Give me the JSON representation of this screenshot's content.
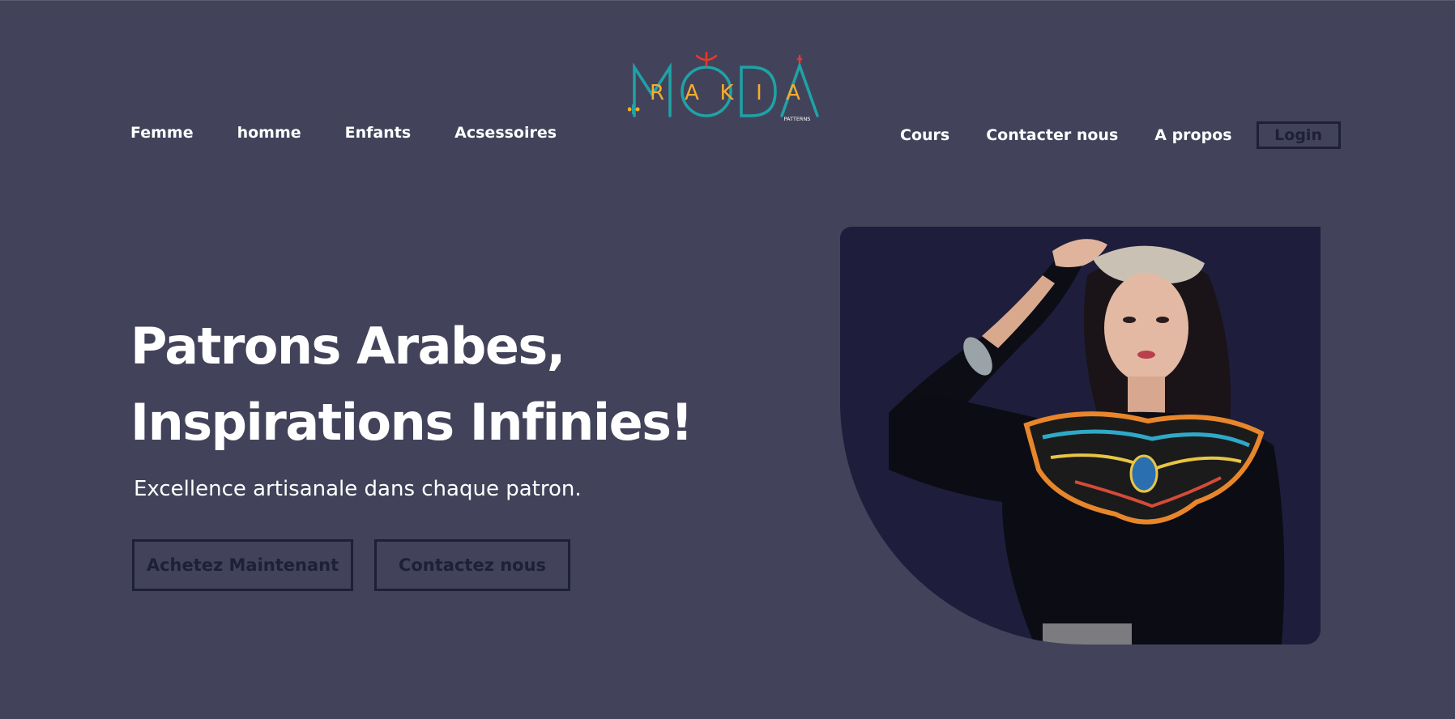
{
  "logo": {
    "brand_word": "MODA",
    "brand_letters": [
      "R",
      "A",
      "K",
      "I",
      "A"
    ],
    "tagline": "PATTERNS",
    "colors": {
      "teal": "#1ea3a6",
      "yellow": "#f3ad2e",
      "red": "#e23b2e"
    }
  },
  "nav": {
    "left": [
      "Femme",
      "homme",
      "Enfants",
      "Acsessoires"
    ],
    "right": [
      "Cours",
      "Contacter nous",
      "A propos"
    ],
    "login_label": "Login"
  },
  "hero": {
    "title_line1": "Patrons Arabes,",
    "title_line2": "Inspirations Infinies!",
    "subtitle": "Excellence artisanale dans chaque patron.",
    "buy_button": "Achetez Maintenant",
    "contact_button": "Contactez nous",
    "image_subject": "woman-in-traditional-dress-photo"
  },
  "colors": {
    "background": "#42435a",
    "button_outline": "#1e1f38",
    "image_background": "#1e1e3c",
    "text": "#ffffff"
  }
}
